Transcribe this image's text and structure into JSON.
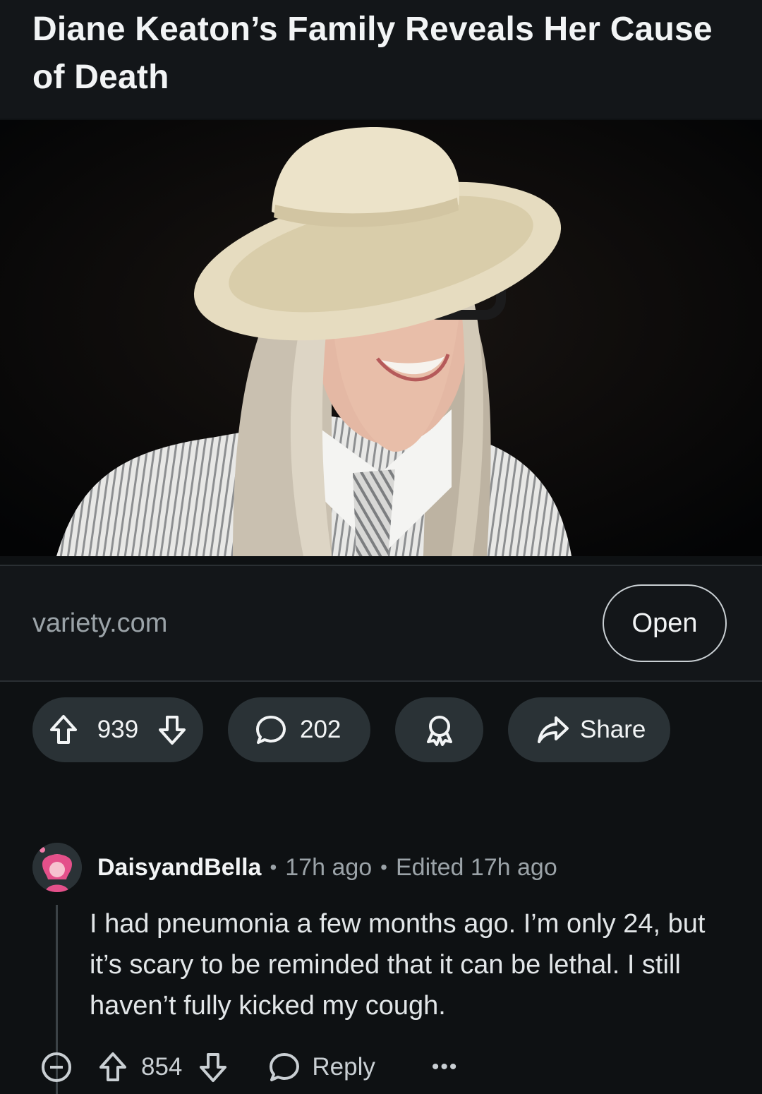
{
  "post": {
    "title": "Diane Keaton’s Family Reveals Her Cause of Death",
    "domain": "variety.com",
    "open_label": "Open",
    "vote_count": "939",
    "comment_count": "202",
    "share_label": "Share"
  },
  "comment": {
    "author": "DaisyandBella",
    "separator": "•",
    "time": "17h ago",
    "edited": "Edited 17h ago",
    "body": "I had pneumonia a few months ago. I’m only 24, but it’s scary to be reminded that it can be lethal. I still haven’t fully kicked my cough.",
    "vote_count": "854",
    "reply_label": "Reply",
    "more_label": "•••"
  },
  "colors": {
    "background": "#0e1113",
    "pill": "#2a3236",
    "muted_text": "#9ba3a8"
  },
  "icons": [
    "upvote-icon",
    "downvote-icon",
    "comment-icon",
    "award-icon",
    "share-icon",
    "collapse-icon",
    "reply-icon",
    "more-icon"
  ]
}
